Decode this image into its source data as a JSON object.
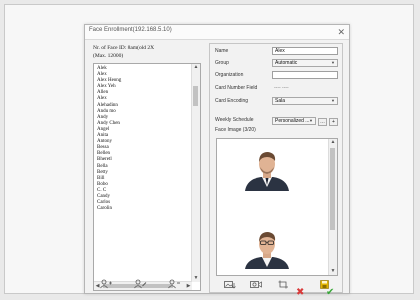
{
  "window": {
    "title": "Face Enrollment(192.168.5.10)",
    "close_glyph": "✕"
  },
  "left_panel": {
    "count_line_1": "Nr. of Face ID: 8am(old 2X",
    "count_line_2": "(Max. 12000)",
    "names": [
      "Alek",
      "Alex",
      "Alex Heong",
      "Alex Yeh",
      "Allen",
      "Alex",
      "Alehadinn",
      "Andu mo",
      "Andy",
      "Andy Chen",
      "Angel",
      "Anita",
      "Antony",
      "Bessa",
      "Bellen",
      "Bheretl",
      "Bella",
      "Betty",
      "Bill",
      "Bobo",
      "C. C",
      "Candy",
      "Carlos",
      "Carolin"
    ],
    "tools": [
      "add-person-icon",
      "edit-person-icon",
      "delete-person-icon"
    ]
  },
  "form": {
    "name_label": "Name",
    "name_value": "Alex",
    "group_label": "Group",
    "group_value": "Automatic",
    "organization_label": "Organization",
    "organization_value": "",
    "card_number_label": "Card Number Field",
    "card_number_value": "----  ----",
    "card_encoding_label": "Card Encoding",
    "card_encoding_value": "Sala",
    "weekly_schedule_label": "Weekly Schedule",
    "weekly_schedule_value": "Personalized ...",
    "edit_button_label": "…",
    "add_button_label": "+",
    "face_image_label": "Face Image (3/20)"
  },
  "photo_tools": [
    "import-photo-icon",
    "capture-photo-icon",
    "crop-photo-icon",
    "save-photo-icon"
  ],
  "bottom_actions": {
    "cancel_glyph": "✖",
    "confirm_glyph": "✔"
  },
  "colors": {
    "cancel": "#d93a3a",
    "confirm": "#39a839",
    "accent_icon": "#e2b400"
  }
}
